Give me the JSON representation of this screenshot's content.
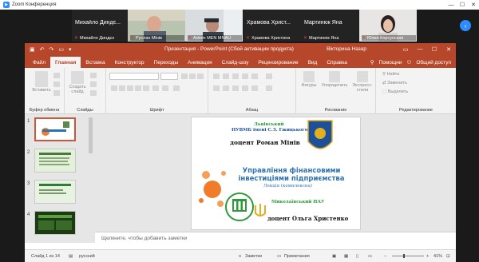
{
  "zoom": {
    "window_title": "Zoom Конференция",
    "participants": [
      {
        "name": "Михайло  Диндє...",
        "label": "Михайло Диндєн",
        "muted": true
      },
      {
        "name": "",
        "label": "Руслан Мінів",
        "muted": true,
        "video": true
      },
      {
        "name": "",
        "label": "Admin MEN MNAU",
        "muted": true,
        "video": true
      },
      {
        "name": "Храмова  Христ...",
        "label": "Храмова Христина",
        "muted": true
      },
      {
        "name": "Мартинюк Яна",
        "label": "Мартинюк Яна",
        "muted": true
      },
      {
        "name": "",
        "label": "Юлия Корсунская",
        "muted": true,
        "video": true
      }
    ]
  },
  "ppt": {
    "title": "Презентация  -  PowerPoint (Сбой активации продукта)",
    "user": "Вікторина Назар",
    "tabs": [
      "Файл",
      "Главная",
      "Вставка",
      "Конструктор",
      "Переходы",
      "Анимация",
      "Слайд-шоу",
      "Рецензирование",
      "Вид",
      "Справка"
    ],
    "tab_right": {
      "help": "Помощни",
      "share": "Общий доступ"
    },
    "ribbon": {
      "paste": "Вставить",
      "create": "Создать",
      "slides_btn": "слайд",
      "groups": [
        "Буфер обмена",
        "Слайды",
        "Шрифт",
        "Абзац",
        "Рисование",
        "Редактирование"
      ],
      "shapes": "Фигуры",
      "arrange": "Упорядочить",
      "express": "Экспресс-стили",
      "find": "Найти",
      "replace": "Заменить",
      "select": "Выделить"
    },
    "thumb_numbers": [
      "1",
      "2",
      "3",
      "4"
    ],
    "notes_placeholder": "Щелкните, чтобы добавить заметки",
    "status": {
      "slide_info": "Слайд 1 из 14",
      "lang": "русский",
      "notes": "Заметки",
      "comments": "Примечания",
      "zoom": "41%"
    },
    "slide": {
      "university_line1": "Львівський",
      "university_line2": "НУВМБ імені С.З. Гжицького",
      "presenter1": "доцент  Роман  Мінів",
      "main_title_1": "Управління  фінансовими",
      "main_title_2": "інвестиціями  підприємства",
      "subtitle": "Лекція (комплексна)",
      "nau": "Миколаївський НАУ",
      "presenter2": "доцент  Ольга  Христенко"
    }
  },
  "colors": {
    "ppt_accent": "#b7472a",
    "zoom_blue": "#2d8cff",
    "slide_orange": "#f07b2b",
    "slide_green": "#2e9a3a",
    "slide_title_blue": "#2e74b5"
  }
}
